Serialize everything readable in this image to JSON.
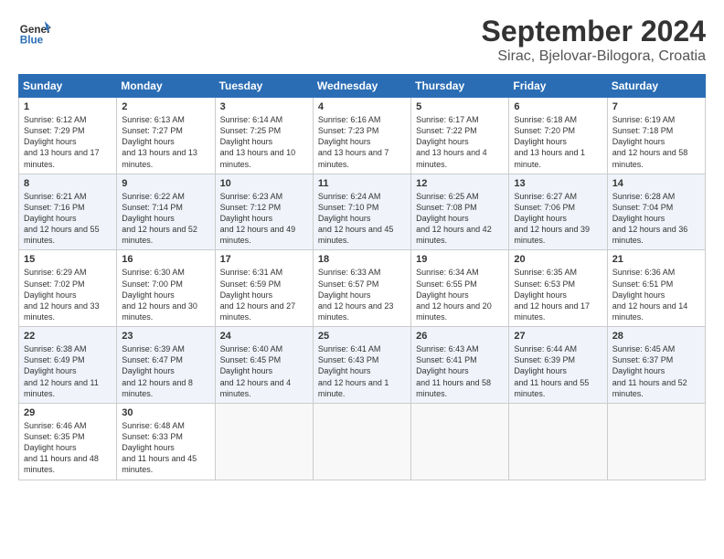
{
  "header": {
    "logo_line1": "General",
    "logo_line2": "Blue",
    "title": "September 2024",
    "subtitle": "Sirac, Bjelovar-Bilogora, Croatia"
  },
  "weekdays": [
    "Sunday",
    "Monday",
    "Tuesday",
    "Wednesday",
    "Thursday",
    "Friday",
    "Saturday"
  ],
  "weeks": [
    [
      {
        "day": "1",
        "sunrise": "6:12 AM",
        "sunset": "7:29 PM",
        "daylight": "13 hours and 17 minutes."
      },
      {
        "day": "2",
        "sunrise": "6:13 AM",
        "sunset": "7:27 PM",
        "daylight": "13 hours and 13 minutes."
      },
      {
        "day": "3",
        "sunrise": "6:14 AM",
        "sunset": "7:25 PM",
        "daylight": "13 hours and 10 minutes."
      },
      {
        "day": "4",
        "sunrise": "6:16 AM",
        "sunset": "7:23 PM",
        "daylight": "13 hours and 7 minutes."
      },
      {
        "day": "5",
        "sunrise": "6:17 AM",
        "sunset": "7:22 PM",
        "daylight": "13 hours and 4 minutes."
      },
      {
        "day": "6",
        "sunrise": "6:18 AM",
        "sunset": "7:20 PM",
        "daylight": "13 hours and 1 minute."
      },
      {
        "day": "7",
        "sunrise": "6:19 AM",
        "sunset": "7:18 PM",
        "daylight": "12 hours and 58 minutes."
      }
    ],
    [
      {
        "day": "8",
        "sunrise": "6:21 AM",
        "sunset": "7:16 PM",
        "daylight": "12 hours and 55 minutes."
      },
      {
        "day": "9",
        "sunrise": "6:22 AM",
        "sunset": "7:14 PM",
        "daylight": "12 hours and 52 minutes."
      },
      {
        "day": "10",
        "sunrise": "6:23 AM",
        "sunset": "7:12 PM",
        "daylight": "12 hours and 49 minutes."
      },
      {
        "day": "11",
        "sunrise": "6:24 AM",
        "sunset": "7:10 PM",
        "daylight": "12 hours and 45 minutes."
      },
      {
        "day": "12",
        "sunrise": "6:25 AM",
        "sunset": "7:08 PM",
        "daylight": "12 hours and 42 minutes."
      },
      {
        "day": "13",
        "sunrise": "6:27 AM",
        "sunset": "7:06 PM",
        "daylight": "12 hours and 39 minutes."
      },
      {
        "day": "14",
        "sunrise": "6:28 AM",
        "sunset": "7:04 PM",
        "daylight": "12 hours and 36 minutes."
      }
    ],
    [
      {
        "day": "15",
        "sunrise": "6:29 AM",
        "sunset": "7:02 PM",
        "daylight": "12 hours and 33 minutes."
      },
      {
        "day": "16",
        "sunrise": "6:30 AM",
        "sunset": "7:00 PM",
        "daylight": "12 hours and 30 minutes."
      },
      {
        "day": "17",
        "sunrise": "6:31 AM",
        "sunset": "6:59 PM",
        "daylight": "12 hours and 27 minutes."
      },
      {
        "day": "18",
        "sunrise": "6:33 AM",
        "sunset": "6:57 PM",
        "daylight": "12 hours and 23 minutes."
      },
      {
        "day": "19",
        "sunrise": "6:34 AM",
        "sunset": "6:55 PM",
        "daylight": "12 hours and 20 minutes."
      },
      {
        "day": "20",
        "sunrise": "6:35 AM",
        "sunset": "6:53 PM",
        "daylight": "12 hours and 17 minutes."
      },
      {
        "day": "21",
        "sunrise": "6:36 AM",
        "sunset": "6:51 PM",
        "daylight": "12 hours and 14 minutes."
      }
    ],
    [
      {
        "day": "22",
        "sunrise": "6:38 AM",
        "sunset": "6:49 PM",
        "daylight": "12 hours and 11 minutes."
      },
      {
        "day": "23",
        "sunrise": "6:39 AM",
        "sunset": "6:47 PM",
        "daylight": "12 hours and 8 minutes."
      },
      {
        "day": "24",
        "sunrise": "6:40 AM",
        "sunset": "6:45 PM",
        "daylight": "12 hours and 4 minutes."
      },
      {
        "day": "25",
        "sunrise": "6:41 AM",
        "sunset": "6:43 PM",
        "daylight": "12 hours and 1 minute."
      },
      {
        "day": "26",
        "sunrise": "6:43 AM",
        "sunset": "6:41 PM",
        "daylight": "11 hours and 58 minutes."
      },
      {
        "day": "27",
        "sunrise": "6:44 AM",
        "sunset": "6:39 PM",
        "daylight": "11 hours and 55 minutes."
      },
      {
        "day": "28",
        "sunrise": "6:45 AM",
        "sunset": "6:37 PM",
        "daylight": "11 hours and 52 minutes."
      }
    ],
    [
      {
        "day": "29",
        "sunrise": "6:46 AM",
        "sunset": "6:35 PM",
        "daylight": "11 hours and 48 minutes."
      },
      {
        "day": "30",
        "sunrise": "6:48 AM",
        "sunset": "6:33 PM",
        "daylight": "11 hours and 45 minutes."
      },
      null,
      null,
      null,
      null,
      null
    ]
  ]
}
